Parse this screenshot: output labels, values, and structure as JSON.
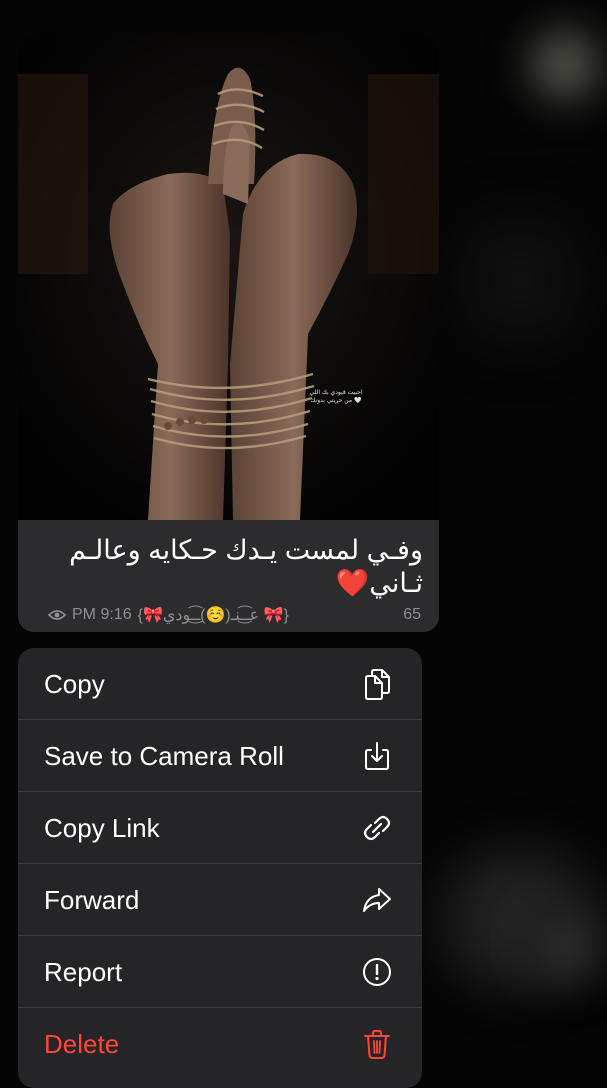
{
  "message": {
    "caption": "وفـي لمست يـدك حـكايه وعالـم ثـاني❤️",
    "image_overlay_text_line1": "احبيت قيودي بك اللي",
    "image_overlay_text_line2": "من حريتي بدونك 🤍",
    "views": "65",
    "author": "{🎀عـ͜͡ـنـ(☺️)ـ͜͡ـودي 🎀}",
    "time": "PM 9:16"
  },
  "menu": {
    "items": [
      {
        "label": "Copy",
        "icon": "copy-icon"
      },
      {
        "label": "Save to Camera Roll",
        "icon": "save-icon"
      },
      {
        "label": "Copy Link",
        "icon": "link-icon"
      },
      {
        "label": "Forward",
        "icon": "forward-icon"
      },
      {
        "label": "Report",
        "icon": "report-icon"
      },
      {
        "label": "Delete",
        "icon": "trash-icon"
      }
    ]
  },
  "colors": {
    "menu_bg": "#252527",
    "bubble_bg": "#2c2c2e",
    "destructive": "#ff453a",
    "meta_text": "#8e8e93"
  }
}
